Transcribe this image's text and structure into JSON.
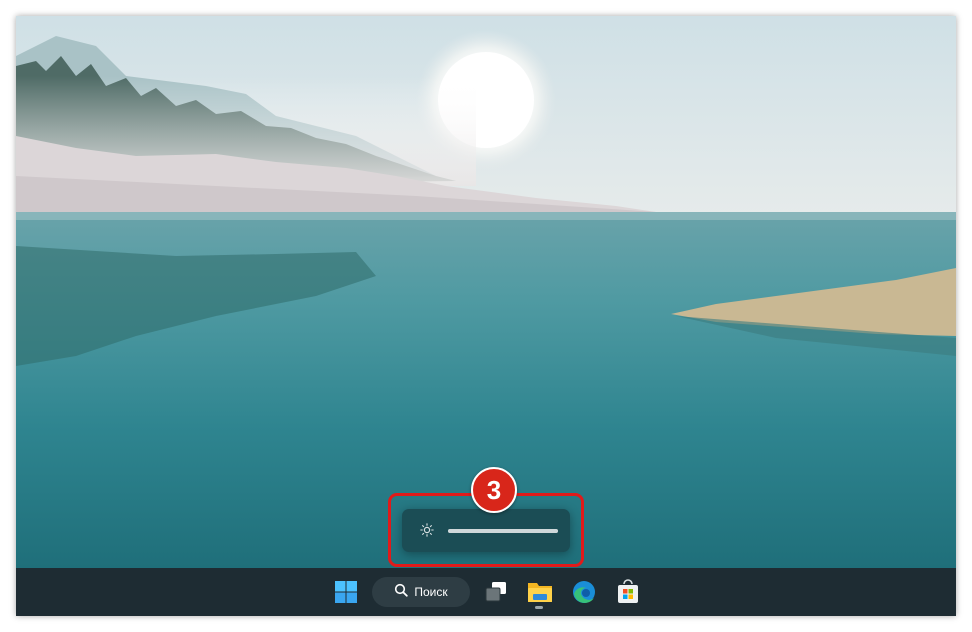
{
  "annotation": {
    "step_number": "3",
    "color": "#e11a1a"
  },
  "brightness_flyout": {
    "icon": "brightness-icon",
    "level_fraction": 1.0
  },
  "taskbar": {
    "search_label": "Поиск",
    "icons": [
      "windows-start-icon",
      "search-icon",
      "task-view-icon",
      "file-explorer-icon",
      "edge-browser-icon",
      "microsoft-store-icon"
    ],
    "accent": "#1e2c33"
  }
}
